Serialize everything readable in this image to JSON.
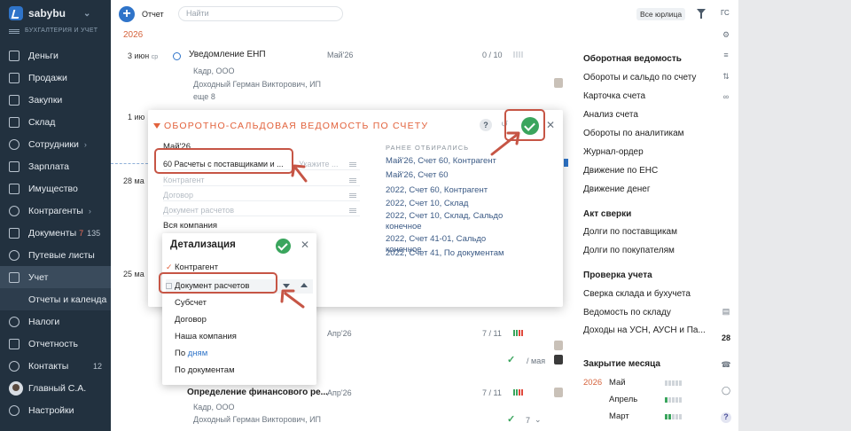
{
  "sidebar": {
    "logo_text": "sabybu",
    "subtitle": "БУХГАЛТЕРИЯ И УЧЕТ",
    "items": [
      {
        "label": "Деньги"
      },
      {
        "label": "Продажи"
      },
      {
        "label": "Закупки"
      },
      {
        "label": "Склад"
      },
      {
        "label": "Сотрудники"
      },
      {
        "label": "Зарплата"
      },
      {
        "label": "Имущество"
      },
      {
        "label": "Контрагенты"
      },
      {
        "label": "Документы",
        "count_red": "7",
        "count": "135"
      },
      {
        "label": "Путевые листы"
      },
      {
        "label": "Учет"
      },
      {
        "label": "Отчеты и календа"
      },
      {
        "label": "Налоги"
      },
      {
        "label": "Отчетность"
      },
      {
        "label": "Контакты",
        "count": "12"
      },
      {
        "label": "Главный С.А."
      },
      {
        "label": "Настройки"
      }
    ]
  },
  "topbar": {
    "add_label": "+",
    "report_label": "Отчет",
    "search_placeholder": "Найти",
    "org_label": "Все юрлица",
    "user_initials": "ГС"
  },
  "year": "2026",
  "feed": {
    "rows": [
      {
        "day": "3",
        "month_word": "июн",
        "dow": "ср",
        "title": "Уведомление ЕНП",
        "org": "Кадр, ООО",
        "sub": "Доходный Герман Викторович, ИП",
        "more": "еще 8",
        "period": "Май'26",
        "score": "0 / 10"
      },
      {
        "day": "1",
        "month_word": "ию"
      },
      {
        "day": "28",
        "month_word": "ма"
      },
      {
        "day": "25",
        "month_word": "ма"
      },
      {
        "period": "Апр'26",
        "score": "7 / 11",
        "date_right": "/ мая"
      },
      {
        "title": "Определение финансового ре...",
        "org": "Кадр, ООО",
        "sub": "Доходный Герман Викторович, ИП",
        "period": "Апр'26",
        "score": "7 / 11",
        "nav": "7"
      }
    ]
  },
  "right_panel": {
    "sections": [
      {
        "title": "Оборотная ведомость",
        "items": [
          "Обороты и сальдо по счету",
          "Карточка счета",
          "Анализ счета",
          "Обороты по аналитикам",
          "Журнал-ордер",
          "Движение по ЕНС",
          "Движение денег"
        ]
      },
      {
        "title": "Акт сверки",
        "items": [
          "Долги по поставщикам",
          "Долги по покупателям"
        ]
      },
      {
        "title": "Проверка учета",
        "items": [
          "Сверка склада и бухучета",
          "Ведомость по складу",
          "Доходы на УСН, АУСН и Па..."
        ]
      },
      {
        "title": "Закрытие месяца",
        "items": []
      }
    ],
    "close_year": "2026",
    "close_months": [
      "Май",
      "Апрель",
      "Март"
    ],
    "calendar_day": "28"
  },
  "modal": {
    "title": "ОБОРОТНО-САЛЬДОВАЯ ВЕДОМОСТЬ ПО СЧЕТУ",
    "help": "?",
    "period": "Май'26",
    "account_value": "60 Расчеты с поставщиками и ...",
    "account_hint": "Укажите ...",
    "fields": [
      "Контрагент",
      "Договор",
      "Документ расчетов"
    ],
    "company": "Вся компания",
    "earlier_heading": "РАНЕЕ ОТБИРАЛИСЬ",
    "earlier": [
      "Май'26, Счет 60, Контрагент",
      "Май'26, Счет 60",
      "2022, Счет 60, Контрагент",
      "2022, Счет 10, Склад",
      "2022, Счет 10, Склад, Сальдо конечное",
      "2022, Счет 41-01, Сальдо конечное",
      "2022, Счет 41, По документам"
    ]
  },
  "detail": {
    "title": "Детализация",
    "checked": "Контрагент",
    "selected": "Документ расчетов",
    "options": [
      "Субсчет",
      "Договор",
      "Наша компания"
    ],
    "by_days_prefix": "По ",
    "by_days_link": "дням",
    "by_docs": "По документам"
  },
  "colors": {
    "sidebar_bg": "#22313f",
    "accent": "#2f74c9",
    "title_orange": "#e2623c",
    "ok_green": "#3aa55d",
    "highlight_red": "#c65545"
  }
}
